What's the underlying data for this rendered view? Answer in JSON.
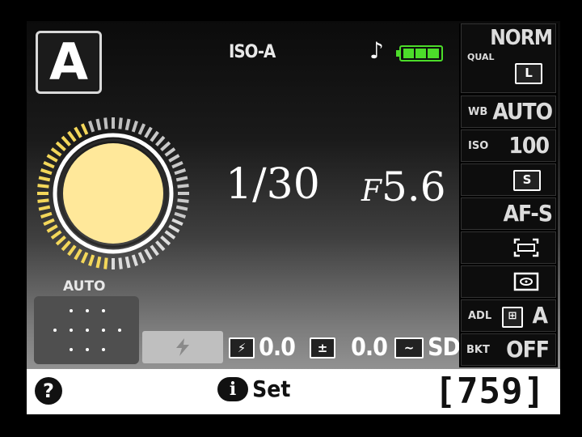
{
  "mode": {
    "label": "A"
  },
  "top": {
    "iso_label": "ISO-A",
    "beep_icon": "music-note-icon",
    "battery_icon": "battery-full-icon"
  },
  "exposure": {
    "shutter_speed": "1/30",
    "aperture_prefix": "F",
    "aperture_value": "5.6"
  },
  "meter": {
    "label": "AUTO"
  },
  "bottom_row": {
    "flash_mode_icon": "flash-icon",
    "flash_comp_value": "0.0",
    "exposure_comp_value": "0.0",
    "picture_control": "SD"
  },
  "right_panel": {
    "quality_label": "QUAL",
    "quality_value": "NORM",
    "image_size": "L",
    "wb_label": "WB",
    "wb_value": "AUTO",
    "iso_label": "ISO",
    "iso_value": "100",
    "release_mode": "S",
    "af_mode": "AF-S",
    "af_area_icon": "af-area-icon",
    "metering_icon": "matrix-metering-icon",
    "adl_label": "ADL",
    "adl_value": "A",
    "bkt_label": "BKT",
    "bkt_value": "OFF"
  },
  "footer": {
    "help": "?",
    "info_button": "i",
    "set_label": "Set",
    "shots_remaining": "[759]"
  },
  "colors": {
    "dial_fill": "#ffe89a",
    "battery_green": "#4cdd2a",
    "panel_bg": "#000000"
  }
}
